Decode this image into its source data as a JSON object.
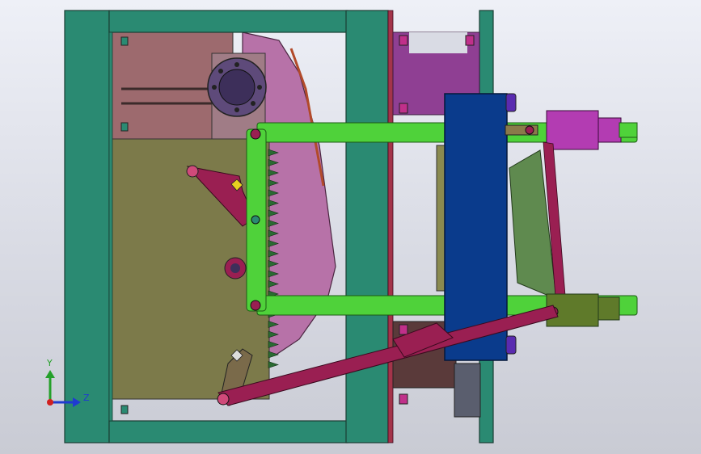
{
  "triad": {
    "y_label": "Y",
    "z_label": "Z"
  },
  "colors": {
    "frame": "#2a8a72",
    "plate": "#7c7a4a",
    "pink_housing": "#b772a8",
    "green_rod": "#4fd23a",
    "blue_block": "#0a3b8c",
    "magenta": "#b33cb2",
    "purple_bracket": "#8f3f93",
    "crimson_link": "#9a1f52",
    "olive_panel": "#5f8a4f",
    "brown_block": "#7a4a4a",
    "rose_top": "#9d6a6e"
  }
}
